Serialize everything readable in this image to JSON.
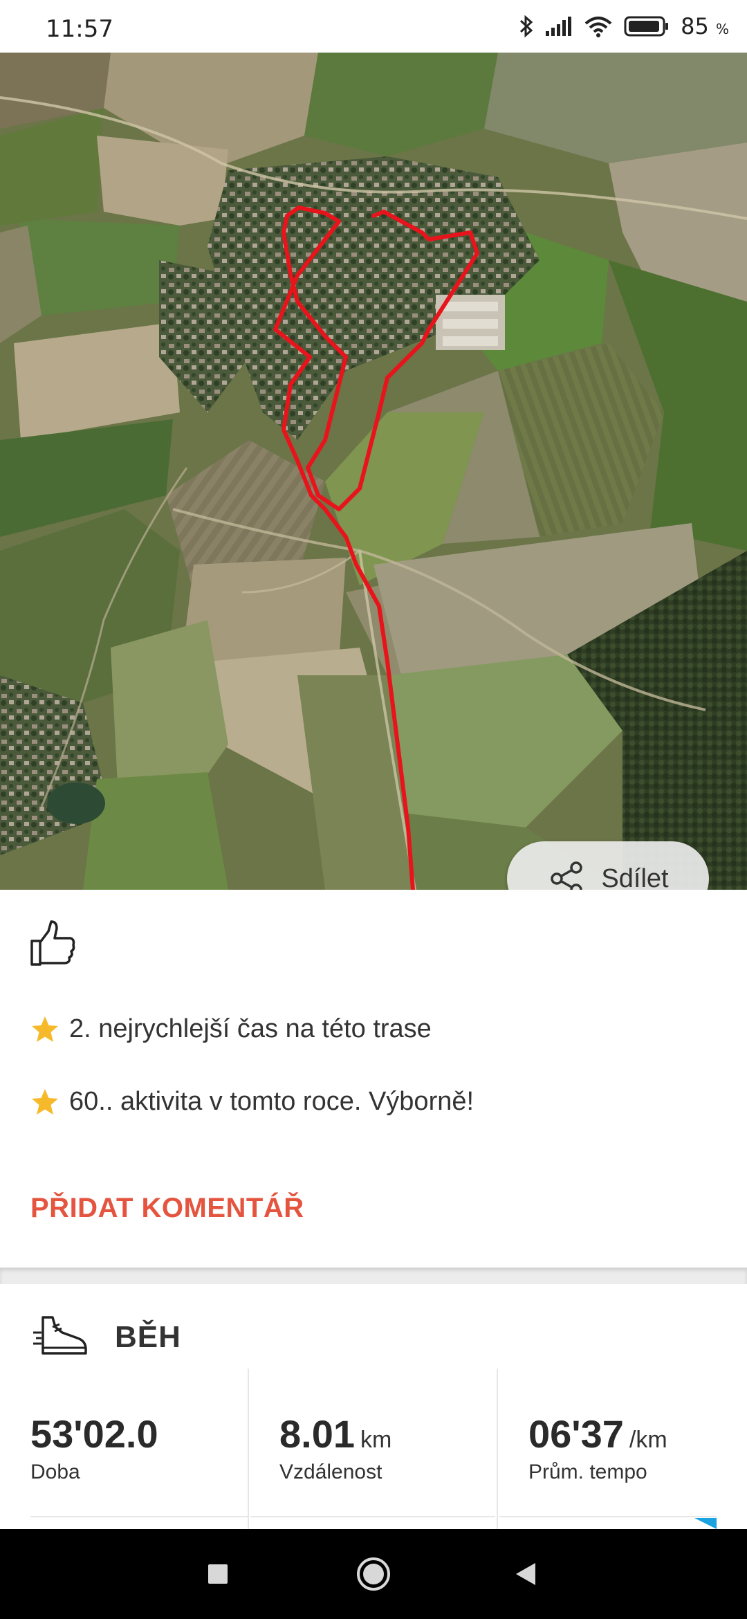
{
  "status_bar": {
    "time": "11:57",
    "battery_percent": "85",
    "battery_symbol": "%",
    "icons": [
      "bluetooth-icon",
      "signal-icon",
      "wifi-icon",
      "battery-icon"
    ]
  },
  "map": {
    "route_color": "#e8141c",
    "share_button": {
      "label": "Sdílet",
      "icon": "share-icon"
    }
  },
  "social": {
    "like_icon": "thumbs-up-icon",
    "achievements": [
      {
        "icon": "star-icon",
        "text": "2. nejrychlejší čas na této trase"
      },
      {
        "icon": "star-icon",
        "text": "60.. aktivita v tomto roce. Výborně!"
      }
    ],
    "add_comment_label": "PŘIDAT KOMENTÁŘ",
    "accent_color": "#e4543f"
  },
  "activity": {
    "sport_icon": "running-shoe-icon",
    "sport_label": "BĚH",
    "stats": [
      {
        "value": "53'02.0",
        "unit": "",
        "label": "Doba"
      },
      {
        "value": "8.01",
        "unit": "km",
        "label": "Vzdálenost"
      },
      {
        "value": "06'37",
        "unit": "/km",
        "label": "Prům. tempo"
      }
    ]
  },
  "navbar": {
    "buttons": [
      "recent-apps-button",
      "home-button",
      "back-button"
    ]
  }
}
